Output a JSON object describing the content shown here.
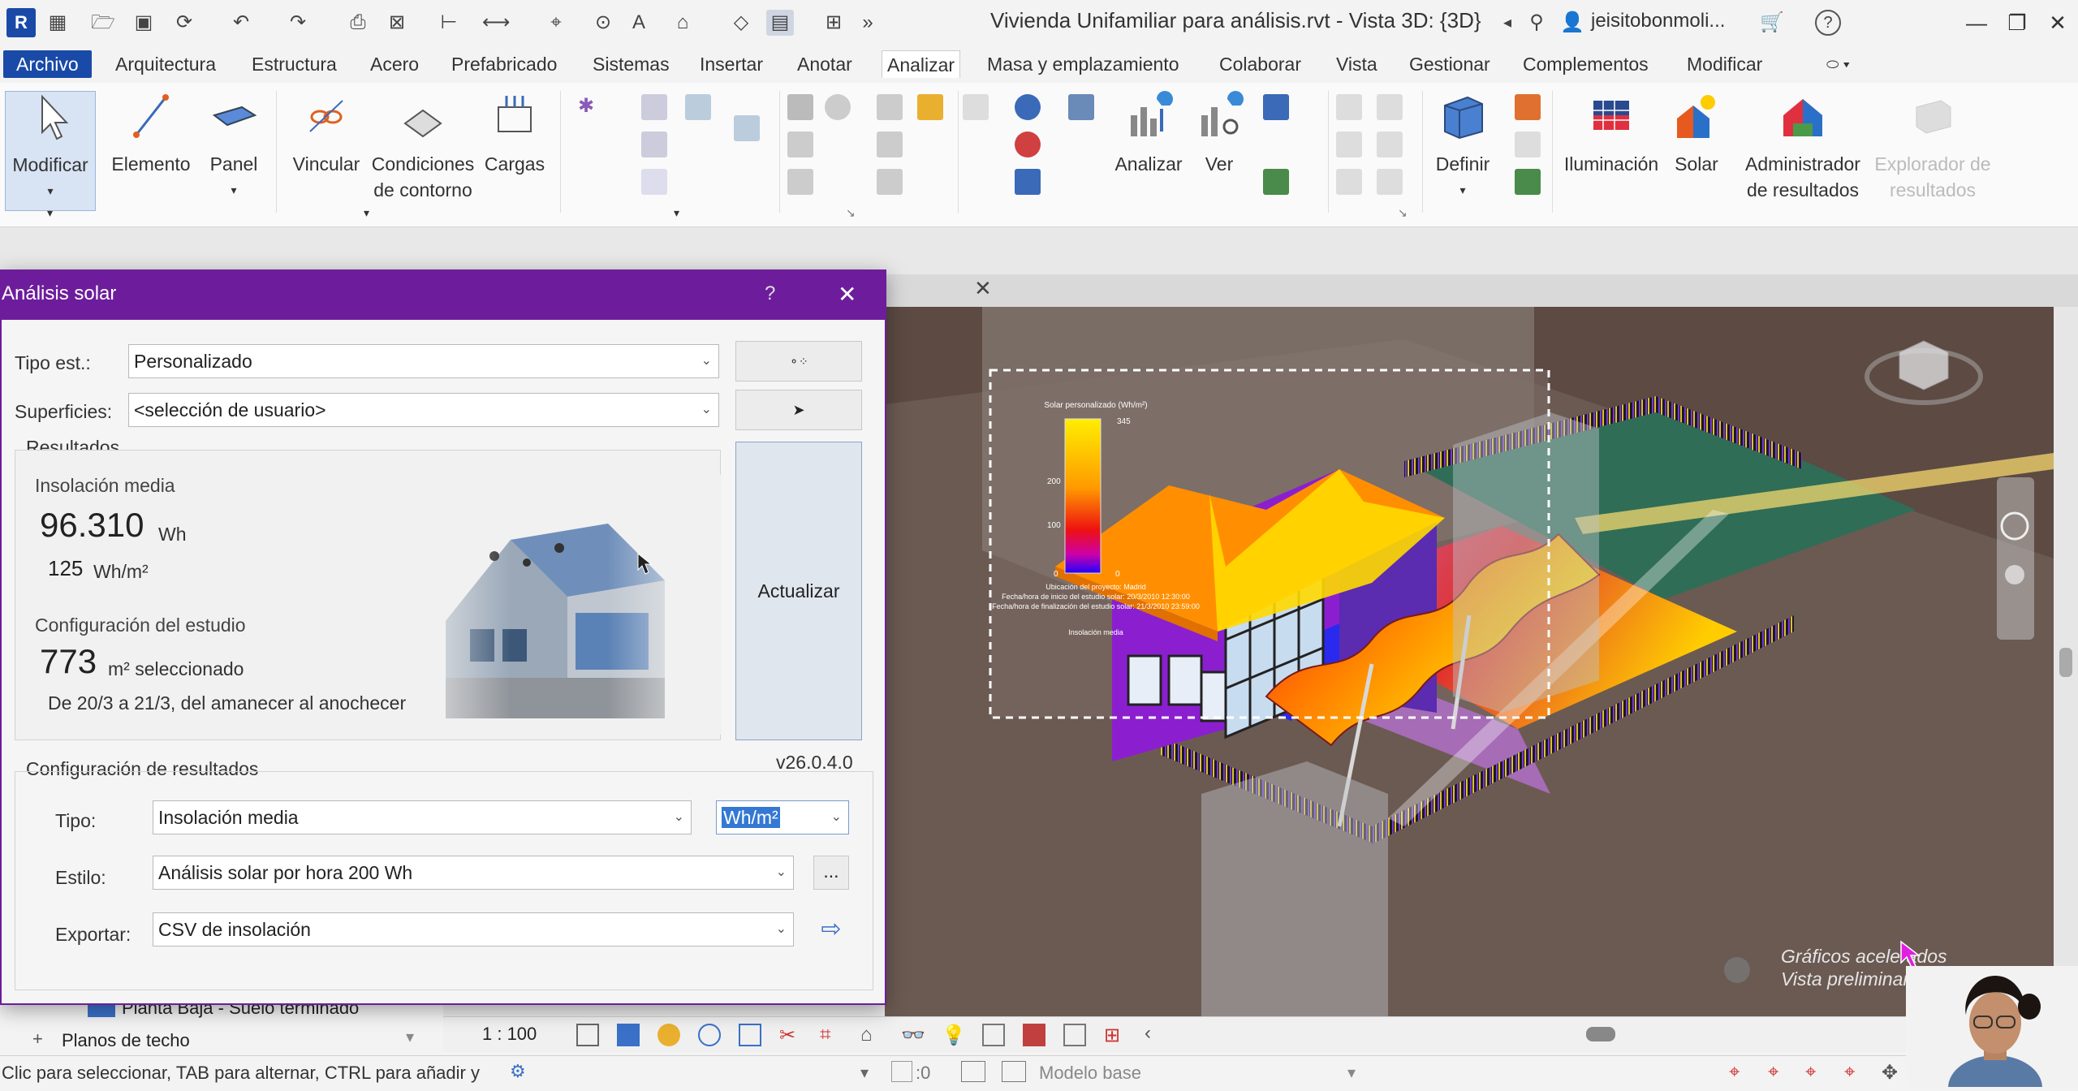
{
  "app": {
    "logo": "R",
    "window_title": "Vivienda Unifamiliar para análisis.rvt - Vista 3D: {3D}",
    "user": "jeisitobonmoli...",
    "help": "?"
  },
  "menu": {
    "tabs": [
      "Archivo",
      "Arquitectura",
      "Estructura",
      "Acero",
      "Prefabricado",
      "Sistemas",
      "Insertar",
      "Anotar",
      "Analizar",
      "Masa y emplazamiento",
      "Colaborar",
      "Vista",
      "Gestionar",
      "Complementos",
      "Modificar"
    ],
    "active": "Analizar"
  },
  "ribbon": {
    "modificar": "Modificar",
    "elemento": "Elemento",
    "panel": "Panel",
    "vincular": "Vincular",
    "condiciones": "Condiciones de contorno",
    "cargas": "Cargas",
    "analizar": "Analizar",
    "ver": "Ver",
    "definir": "Definir",
    "iluminacion": "Iluminación",
    "solar": "Solar",
    "administrador": "Administrador de resultados",
    "explorador": "Explorador de resultados"
  },
  "dialog": {
    "title": "Análisis solar",
    "help": "?",
    "close": "✕",
    "tipo_est_label": "Tipo est.:",
    "tipo_est_value": "Personalizado",
    "superficies_label": "Superficies:",
    "superficies_value": "<selección de usuario>",
    "resultados_title": "Resultados",
    "insolacion_label": "Insolación media",
    "insolacion_value": "96.310",
    "insolacion_unit": "Wh",
    "insolacion_area_value": "125",
    "insolacion_area_unit": "Wh/m²",
    "config_estudio_label": "Configuración del estudio",
    "area_value": "773",
    "area_unit": "m² seleccionado",
    "date_range": "De 20/3 a 21/3, del amanecer al anochecer",
    "actualizar": "Actualizar",
    "version": "v26.0.4.0",
    "config_resultados_title": "Configuración de resultados",
    "tipo_label": "Tipo:",
    "tipo_value": "Insolación media",
    "unit_select": "Wh/m²",
    "estilo_label": "Estilo:",
    "estilo_value": "Análisis solar por hora 200 Wh",
    "estilo_more": "...",
    "exportar_label": "Exportar:",
    "exportar_value": "CSV de insolación"
  },
  "legend": {
    "title": "Solar personalizado (Wh/m²)",
    "tick_max": "345",
    "tick_200": "200",
    "tick_100": "100",
    "tick_0a": "0",
    "tick_0b": "0",
    "line1": "Ubicación del proyecto: Madrid",
    "line2": "Fecha/hora de inicio del estudio solar: 20/3/2010 12:30:00",
    "line3": "Fecha/hora de finalización del estudio solar: 21/3/2010 23:59:00",
    "caption": "Insolación media"
  },
  "viewport": {
    "overlay_line1": "Gráficos acelerados",
    "overlay_line2": "Vista preliminar",
    "close_tab": "✕"
  },
  "browser": {
    "item1": "Planta Baja - Suelo terminado",
    "item2": "Planos de techo",
    "expand": "+"
  },
  "view_bar": {
    "scale": "1 : 100"
  },
  "status": {
    "message": "Clic para seleccionar, TAB para alternar, CTRL para añadir y",
    "count": ":0",
    "model": "Modelo base"
  },
  "colors": {
    "accent_blue": "#1a4aa8",
    "dialog_purple": "#6d1d9c",
    "heat_yellow": "#ffeb00",
    "heat_orange": "#ff8c00",
    "heat_red": "#e60000",
    "heat_blue": "#0000ff",
    "wall_purple": "#8b1fd0"
  }
}
